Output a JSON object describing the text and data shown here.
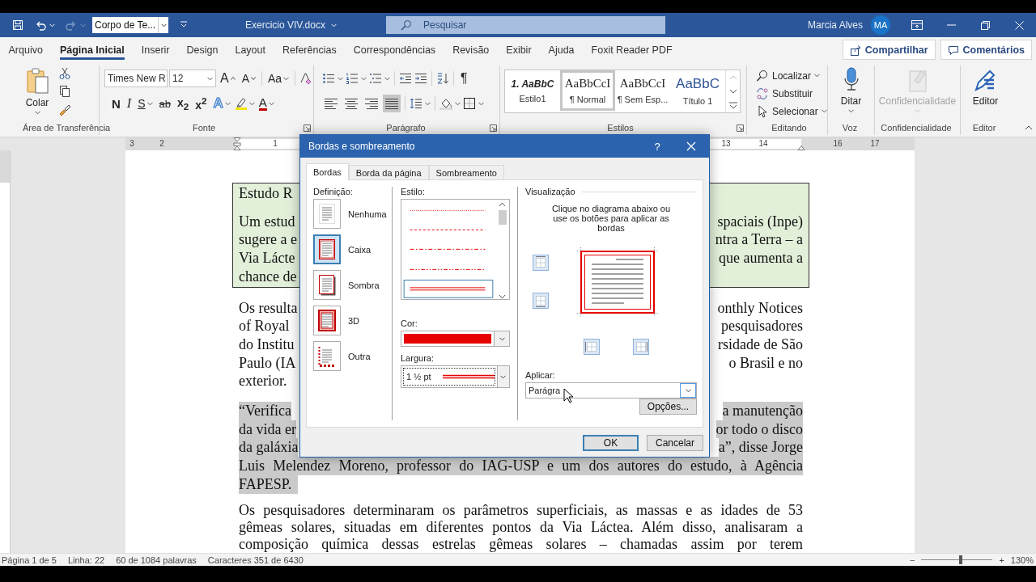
{
  "title_bar": {
    "style_box": "Corpo de Te...",
    "document_title": "Exercicio VIV.docx",
    "search": {
      "placeholder": "Pesquisar"
    },
    "user_name": "Marcia Alves",
    "avatar": "MA"
  },
  "tabs": [
    {
      "label": "Arquivo",
      "selected": false
    },
    {
      "label": "Página Inicial",
      "selected": true
    },
    {
      "label": "Inserir",
      "selected": false
    },
    {
      "label": "Design",
      "selected": false
    },
    {
      "label": "Layout",
      "selected": false
    },
    {
      "label": "Referências",
      "selected": false
    },
    {
      "label": "Correspondências",
      "selected": false
    },
    {
      "label": "Revisão",
      "selected": false
    },
    {
      "label": "Exibir",
      "selected": false
    },
    {
      "label": "Ajuda",
      "selected": false
    },
    {
      "label": "Foxit Reader PDF",
      "selected": false
    }
  ],
  "actions": {
    "share": "Compartilhar",
    "comments": "Comentários"
  },
  "ribbon": {
    "clipboard": {
      "paste": "Colar",
      "label": "Área de Transferência"
    },
    "font": {
      "family": "Times New R",
      "size": "12",
      "grow": "A",
      "shrink": "A",
      "change_case": "Aa",
      "format": [
        {
          "kind": "bold",
          "text": "N"
        },
        {
          "kind": "italic",
          "text": "I"
        },
        {
          "kind": "underline",
          "text": "S"
        },
        {
          "kind": "strike",
          "text": "ab"
        },
        {
          "kind": "subscript",
          "text": "x$_{2}$"
        },
        {
          "kind": "superscript",
          "text": "x$^{2}$"
        },
        {
          "kind": "effects",
          "text": "A"
        },
        {
          "kind": "highlight"
        },
        {
          "kind": "color",
          "text": "A"
        }
      ],
      "label": "Fonte"
    },
    "paragraph": {
      "pilcrow": "¶",
      "align": [
        {
          "kind": "left",
          "selected": false
        },
        {
          "kind": "center",
          "selected": false
        },
        {
          "kind": "right",
          "selected": false
        },
        {
          "kind": "justify",
          "selected": true
        }
      ],
      "label": "Parágrafo"
    },
    "styles": {
      "items": [
        {
          "kind": "emphasis",
          "sample": "1. AaBbC",
          "name": "Estilo1",
          "selected": false
        },
        {
          "kind": "normal",
          "sample": "AaBbCcI",
          "name": "¶ Normal",
          "selected": true
        },
        {
          "kind": "normal",
          "sample": "AaBbCcI",
          "name": "¶ Sem Esp...",
          "selected": false
        },
        {
          "kind": "heading",
          "sample": "AaBbC",
          "name": "Título 1",
          "selected": false
        }
      ],
      "label": "Estilos"
    },
    "editing": {
      "items": [
        {
          "kind": "find",
          "label": "Localizar"
        },
        {
          "kind": "replace",
          "label": "Substituir"
        },
        {
          "kind": "select",
          "label": "Selecionar"
        }
      ],
      "label": "Editando"
    },
    "voice": {
      "button": "Ditar",
      "label": "Voz"
    },
    "sensitivity": {
      "button": "Confidencialidade",
      "disabled": true,
      "label": "Confidencialidade"
    },
    "editor": {
      "button": "Editor",
      "label": "Editor"
    }
  },
  "ruler": {
    "labels": [
      "3",
      "2",
      "1",
      "13",
      "14",
      "16",
      "17"
    ]
  },
  "document": {
    "blocks": [
      {
        "kind": "boxed",
        "paragraphs": [
          [
            {
              "left": "Estudo R"
            }
          ],
          [
            {
              "left": "Um estud",
              "right": "spaciais (Inpe)"
            },
            {
              "left": "sugere a e",
              "right": "ntra a Terra – a"
            },
            {
              "left": "Via Lácte",
              "right": "que aumenta a"
            },
            {
              "left": "chance de"
            }
          ]
        ]
      },
      {
        "kind": "plain",
        "paragraphs": [
          [
            {
              "left": "Os resulta",
              "right": "onthly Notices"
            },
            {
              "left": "of Royal",
              "right": "pesquisadores"
            },
            {
              "left": "do Institu",
              "right": "rsidade de São"
            },
            {
              "left": "Paulo (IA",
              "right": "o Brasil e no"
            },
            {
              "left": "exterior."
            }
          ]
        ]
      },
      {
        "kind": "selected",
        "paragraphs": [
          [
            {
              "left": "“Verifica",
              "right": "a manutenção"
            },
            {
              "left": "da vida er",
              "right": "or todo o disco"
            },
            {
              "left": "da galáxia",
              "right": "a”, disse Jorge"
            },
            {
              "text": "Luis Melendez Moreno, professor do IAG-USP e um dos autores do estudo, à Agência",
              "justified": true
            },
            {
              "text": "FAPESP.",
              "justified": false
            }
          ]
        ]
      },
      {
        "kind": "plain",
        "paragraphs": [
          [
            {
              "text": "Os pesquisadores determinaram os parâmetros superficiais, as massas e as idades de 53",
              "justified": true
            },
            {
              "text": "gêmeas solares, situadas em diferentes pontos da Via Láctea. Além disso, analisaram a",
              "justified": true
            },
            {
              "text": "composição química dessas estrelas gêmeas solares – chamadas assim por terem",
              "justified": true
            }
          ]
        ]
      }
    ]
  },
  "dialog": {
    "title": "Bordas e sombreamento",
    "help": "?",
    "tabs": [
      {
        "label": "Bordas",
        "selected": true
      },
      {
        "label": "Borda da página",
        "selected": false
      },
      {
        "label": "Sombreamento",
        "selected": false
      }
    ],
    "setting_label": "Definição:",
    "settings": [
      {
        "kind": "none",
        "label": "Nenhuma",
        "selected": false
      },
      {
        "kind": "box",
        "label": "Caixa",
        "selected": true
      },
      {
        "kind": "shadow",
        "label": "Sombra",
        "selected": false
      },
      {
        "kind": "raised",
        "label": "3D",
        "selected": false
      },
      {
        "kind": "custom",
        "label": "Outra",
        "selected": false
      }
    ],
    "style_label": "Estilo:",
    "styles": [
      {
        "kind": "dotted",
        "selected": false
      },
      {
        "kind": "dashed",
        "selected": false
      },
      {
        "kind": "dash-dot",
        "selected": false
      },
      {
        "kind": "dash-dot-dot",
        "selected": false
      },
      {
        "kind": "double",
        "selected": true
      }
    ],
    "color_label": "Cor:",
    "color": "#e60000",
    "width_label": "Largura:",
    "width": "1 ½ pt",
    "preview_label": "Visualização",
    "preview_hint": "Clique no diagrama abaixo ou use os botões para aplicar as bordas",
    "apply_label": "Aplicar:",
    "apply": "Parágra",
    "options": "Opções...",
    "ok": "OK",
    "cancel": "Cancelar"
  },
  "status_bar": {
    "page": "Página 1 de 5",
    "line": "Linha: 22",
    "words": "60 de 1084 palavras",
    "characters": "Caracteres 351 de 6430",
    "zoom_out": "−",
    "zoom_in": "+",
    "zoom": {
      "level": 0.55
    },
    "zoom_percent": "130%"
  }
}
